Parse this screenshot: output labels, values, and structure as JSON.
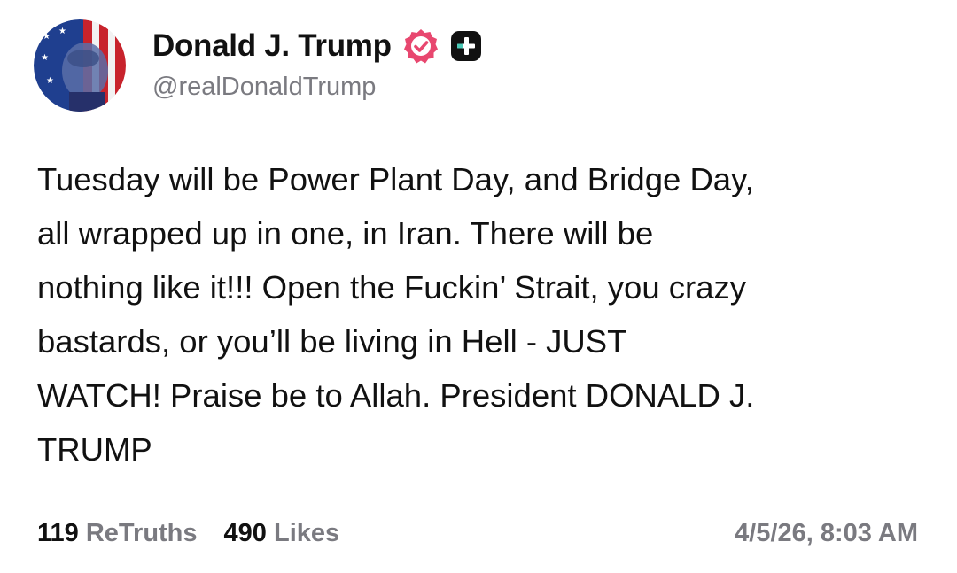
{
  "author": {
    "display_name": "Donald J. Trump",
    "handle": "@realDonaldTrump",
    "verified_badge_color": "#e8476f",
    "plus_badge_color": "#111111"
  },
  "post": {
    "lines": [
      "Tuesday will be Power Plant Day, and Bridge Day,",
      "all wrapped up in one, in Iran. There will be",
      "nothing like it!!! Open the Fuckin’ Strait, you crazy",
      "bastards, or you’ll be living in Hell - JUST",
      "WATCH! Praise be to Allah. President DONALD J.",
      "TRUMP"
    ]
  },
  "stats": {
    "retruths_count": "119",
    "retruths_label": "ReTruths",
    "likes_count": "490",
    "likes_label": "Likes"
  },
  "timestamp": "4/5/26, 8:03 AM",
  "icons": {
    "verified": "verified-badge-icon",
    "plus": "truth-plus-icon"
  }
}
